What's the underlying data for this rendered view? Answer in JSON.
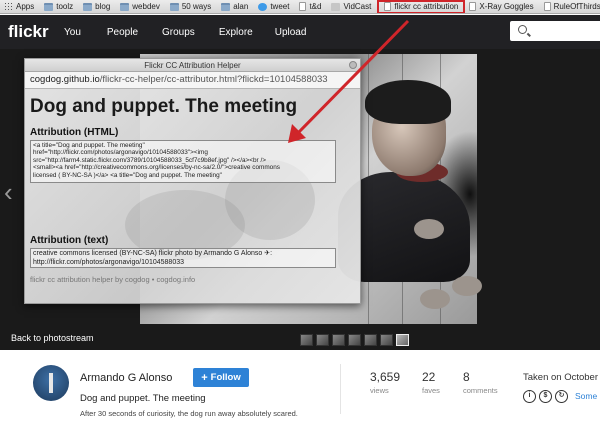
{
  "bookmarks": [
    {
      "label": "Apps",
      "icon": "apps-icon"
    },
    {
      "label": "toolz",
      "icon": "folder-icon"
    },
    {
      "label": "blog",
      "icon": "folder-icon"
    },
    {
      "label": "webdev",
      "icon": "folder-icon"
    },
    {
      "label": "50 ways",
      "icon": "folder-icon"
    },
    {
      "label": "alan",
      "icon": "folder-icon"
    },
    {
      "label": "tweet",
      "icon": "twitter-icon"
    },
    {
      "label": "t&d",
      "icon": "page-icon"
    },
    {
      "label": "VidCast",
      "icon": "vidcast-icon"
    },
    {
      "label": "flickr cc attribution",
      "icon": "page-icon",
      "active": true
    },
    {
      "label": "X-Ray Goggles",
      "icon": "page-icon"
    },
    {
      "label": "RuleOfThirds",
      "icon": "page-icon"
    }
  ],
  "nav": {
    "logo": "flickr",
    "links": [
      "You",
      "People",
      "Groups",
      "Explore",
      "Upload"
    ]
  },
  "popup": {
    "window_title": "Flickr CC Attribution Helper",
    "url_host": "cogdog.github.io",
    "url_path": "/flickr-cc-helper/cc-attributor.html?flickd=10104588033",
    "heading": "Dog and puppet. The meeting",
    "html_label": "Attribution (HTML)",
    "html_lines": [
      "<a title=\"Dog and puppet. The meeting\"",
      "href=\"http://flickr.com/photos/argonavigo/10104588033\"><img",
      "src=\"http://farm4.static.flickr.com/3789/10104588033_5cf7c9b8ef.jpg\" /></a><br />",
      "<small><a href=\"http://creativecommons.org/licenses/by-nc-sa/2.0/\">creative commons",
      "licensed ( BY-NC-SA )</a> <a title=\"Dog and puppet. The meeting\""
    ],
    "text_label": "Attribution (text)",
    "text_lines": [
      "creative commons licensed (BY-NC-SA) flickr photo by Armando G Alonso ✈:",
      "http://flickr.com/photos/argonavigo/10104588033"
    ],
    "credit": "flickr cc attribution helper by cogdog • cogdog.info"
  },
  "photo_footer": {
    "back_link": "Back to photostream",
    "thumb_count": 7,
    "selected_thumb": 6
  },
  "info": {
    "owner": "Armando G Alonso",
    "follow_label": "Follow",
    "title": "Dog and puppet. The meeting",
    "description": "After 30 seconds of curiosity, the dog run away absolutely scared.",
    "stats": [
      {
        "value": "3,659",
        "label": "views"
      },
      {
        "value": "22",
        "label": "faves"
      },
      {
        "value": "8",
        "label": "comments"
      }
    ],
    "taken": "Taken on October",
    "license_icons": [
      "cc-info-icon",
      "cc-nc-icon",
      "cc-sa-icon"
    ],
    "some_rights": "Some r"
  },
  "colors": {
    "flickr_nav": "#212124",
    "follow": "#2e82d6",
    "highlight": "#d0252a"
  }
}
